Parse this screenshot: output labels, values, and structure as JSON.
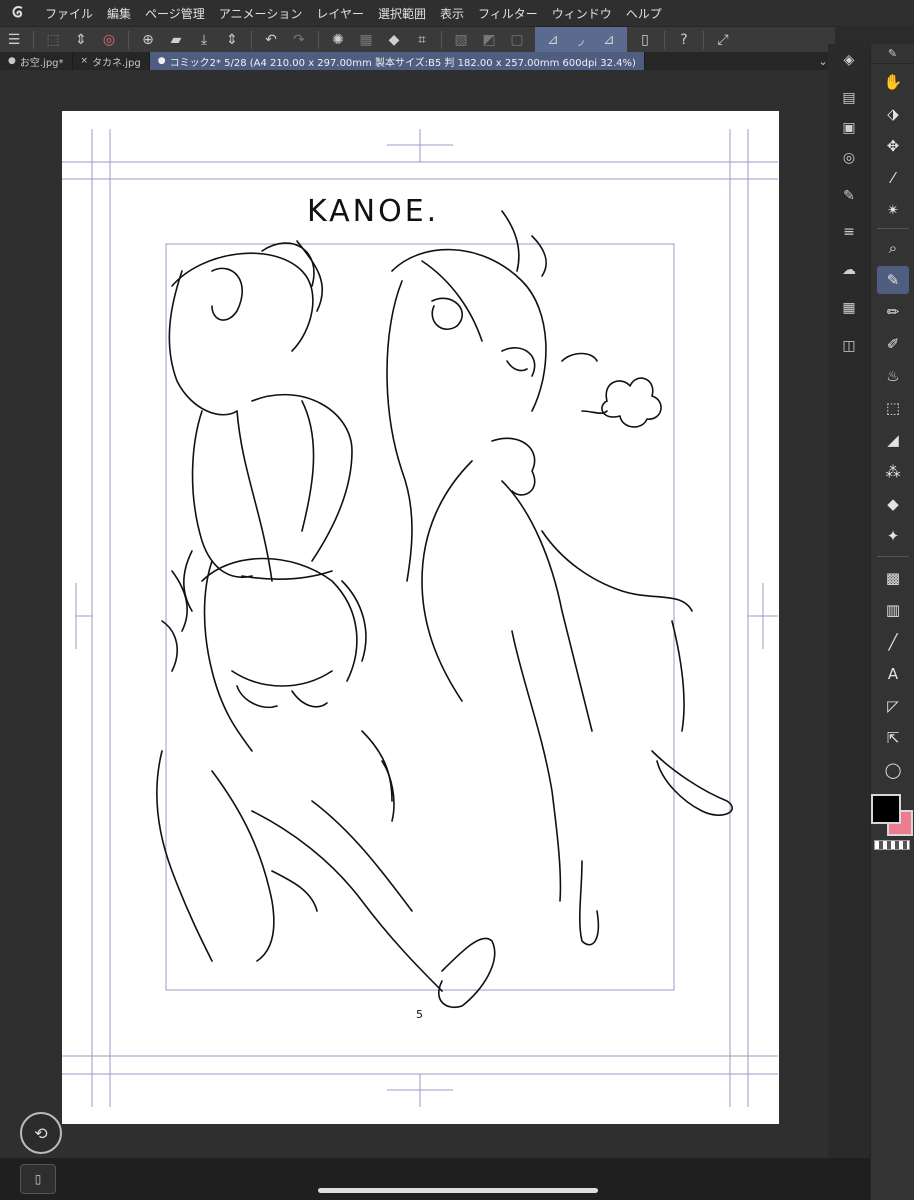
{
  "menu": {
    "items": [
      "ファイル",
      "編集",
      "ページ管理",
      "アニメーション",
      "レイヤー",
      "選択範囲",
      "表示",
      "フィルター",
      "ウィンドウ",
      "ヘルプ"
    ]
  },
  "tabs": [
    {
      "label": "お空.jpg*",
      "mark": "●",
      "active": false
    },
    {
      "label": "タカネ.jpg",
      "mark": "×",
      "active": false
    },
    {
      "label": "コミック2* 5/28 (A4 210.00 x 297.00mm 製本サイズ:B5 判 182.00 x 257.00mm 600dpi 32.4%)",
      "mark": "●",
      "active": true
    }
  ],
  "canvas": {
    "title_text": "KANOE.",
    "page_number": "5"
  },
  "colors": {
    "main": "#000000",
    "sub": "#ec7d8e",
    "accent": "#4f5d80"
  },
  "icons": {
    "toolbar": [
      "menu-icon",
      "transform-icon",
      "stepper-icon",
      "clip-logo-icon",
      "new-page-icon",
      "open-folder-icon",
      "save-icon",
      "undo-icon",
      "redo-icon",
      "loading-icon",
      "fill-icon",
      "crop-icon",
      "grid-icon",
      "ruler-icon",
      "help-icon",
      "resize-icon"
    ],
    "tools": [
      "hand-icon",
      "object-icon",
      "move-icon",
      "eyedropper-icon",
      "magic-wand-icon",
      "zoom-icon",
      "pen-icon",
      "pencil-icon",
      "brush-icon",
      "airbrush-icon",
      "select-icon",
      "eraser-icon",
      "decorate-icon",
      "fill-icon",
      "sparkle-icon",
      "gradient-icon",
      "frame-icon",
      "line-icon",
      "text-icon",
      "ruler-icon",
      "correction-icon",
      "balloon-icon"
    ]
  }
}
